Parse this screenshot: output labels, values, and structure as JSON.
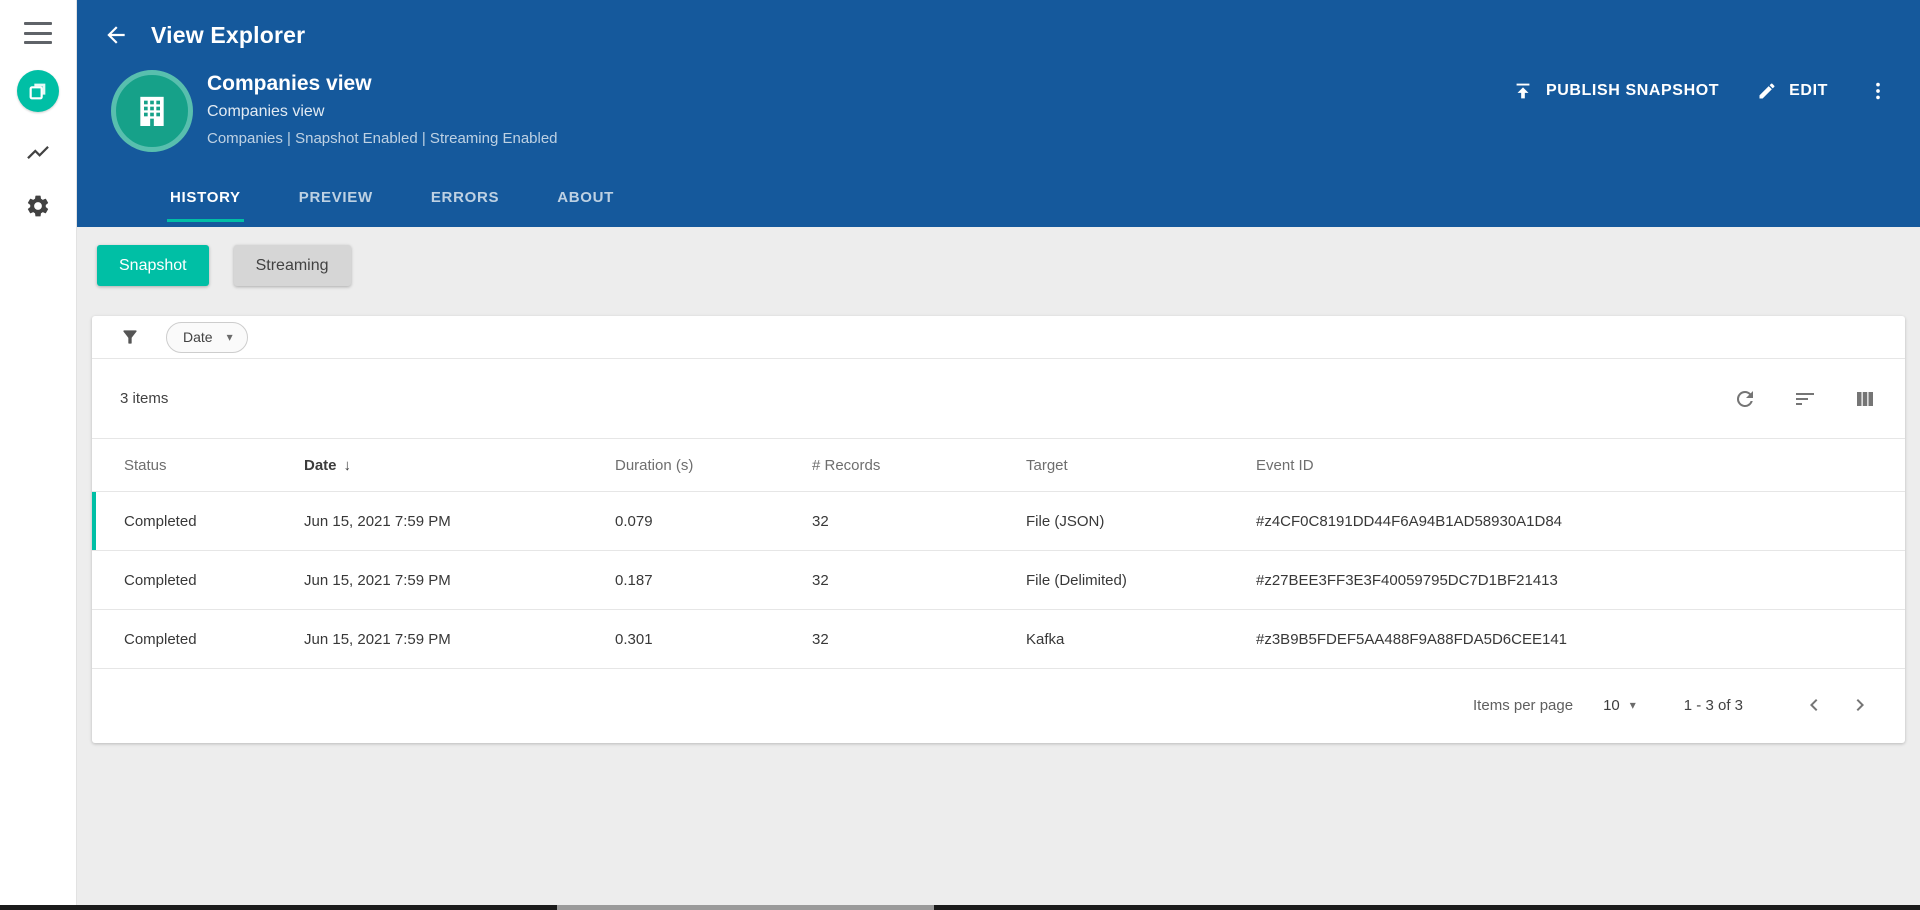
{
  "colors": {
    "header_blue": "#15599C",
    "accent_teal": "#00BFA5",
    "avatar_green": "#16A189",
    "avatar_ring": "#58BFAE"
  },
  "sidebar": {
    "icons": [
      "menu-icon",
      "app-logo-icon",
      "activity-icon",
      "settings-icon"
    ]
  },
  "header": {
    "app_title": "View Explorer",
    "view": {
      "title": "Companies view",
      "subtitle": "Companies view",
      "meta": "Companies | Snapshot Enabled | Streaming Enabled"
    },
    "actions": {
      "publish": "PUBLISH SNAPSHOT",
      "edit": "EDIT"
    },
    "tabs": [
      {
        "label": "HISTORY"
      },
      {
        "label": "PREVIEW"
      },
      {
        "label": "ERRORS"
      },
      {
        "label": "ABOUT"
      }
    ]
  },
  "toggles": {
    "snapshot": "Snapshot",
    "streaming": "Streaming"
  },
  "filters": {
    "chip": "Date"
  },
  "table": {
    "items_count": "3 items",
    "columns": [
      "Status",
      "Date",
      "Duration (s)",
      "# Records",
      "Target",
      "Event ID"
    ],
    "sort_indicator": "↓",
    "rows": [
      {
        "status": "Completed",
        "date": "Jun 15, 2021 7:59 PM",
        "duration": "0.079",
        "records": "32",
        "target": "File (JSON)",
        "event_id": "#z4CF0C8191DD44F6A94B1AD58930A1D84"
      },
      {
        "status": "Completed",
        "date": "Jun 15, 2021 7:59 PM",
        "duration": "0.187",
        "records": "32",
        "target": "File (Delimited)",
        "event_id": "#z27BEE3FF3E3F40059795DC7D1BF21413"
      },
      {
        "status": "Completed",
        "date": "Jun 15, 2021 7:59 PM",
        "duration": "0.301",
        "records": "32",
        "target": "Kafka",
        "event_id": "#z3B9B5FDEF5AA488F9A88FDA5D6CEE141"
      }
    ],
    "pagination": {
      "label": "Items per page",
      "per_page": "10",
      "range": "1 - 3 of 3"
    }
  },
  "icons": {
    "caret_down": "▾"
  }
}
